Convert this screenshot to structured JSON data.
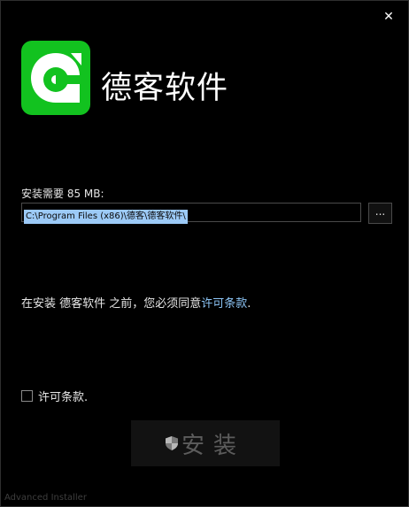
{
  "window": {
    "close_glyph": "✕"
  },
  "header": {
    "logo_icon": "green-app-logo-icon",
    "logo_color": "#12c21f",
    "title": "德客软件"
  },
  "install": {
    "space_label": "安装需要 85 MB:",
    "path_value": "C:\\Program Files (x86)\\德客\\德客软件\\",
    "browse_label": "..."
  },
  "license": {
    "notice_prefix": "在安装 德客软件 之前，您必须同意",
    "notice_link": "许可条款",
    "notice_suffix": ".",
    "checkbox_label": "许可条款.",
    "checkbox_checked": false
  },
  "actions": {
    "shield_icon": "uac-shield-icon",
    "install_label": "安装"
  },
  "footer": {
    "brand": "Advanced Installer"
  },
  "colors": {
    "background": "#000000",
    "link": "#8cc4f5",
    "selection": "#9ccaf7"
  }
}
